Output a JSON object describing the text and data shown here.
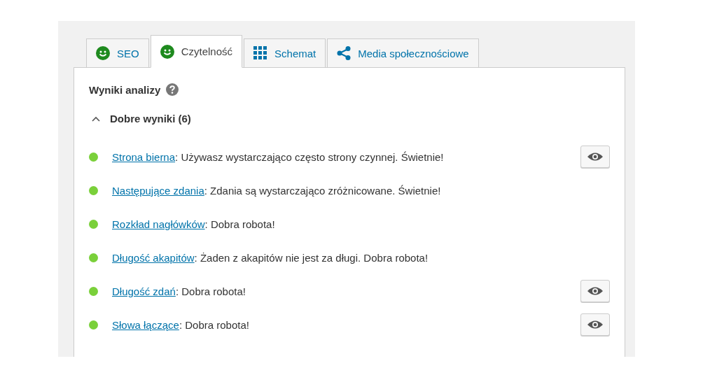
{
  "tabs": [
    {
      "label": "SEO",
      "kind": "smiley",
      "color": "#1e8a1e",
      "selected": false
    },
    {
      "label": "Czytelność",
      "kind": "smiley",
      "color": "#1e8a1e",
      "selected": true
    },
    {
      "label": "Schemat",
      "kind": "grid",
      "selected": false
    },
    {
      "label": "Media społecznościowe",
      "kind": "share",
      "selected": false
    }
  ],
  "analysis": {
    "title": "Wyniki analizy",
    "group": {
      "label": "Dobre wyniki (6)",
      "expanded": true,
      "results": [
        {
          "color": "#7ad03a",
          "link": "Strona bierna",
          "text": ": Używasz wystarczająco często strony czynnej. Świetnie!",
          "highlight_button": true
        },
        {
          "color": "#7ad03a",
          "link": "Następujące zdania",
          "text": ": Zdania są wystarczająco zróżnicowane. Świetnie!",
          "highlight_button": false
        },
        {
          "color": "#7ad03a",
          "link": "Rozkład nagłówków",
          "text": ": Dobra robota!",
          "highlight_button": false
        },
        {
          "color": "#7ad03a",
          "link": "Długość akapitów",
          "text": ": Żaden z akapitów nie jest za długi. Dobra robota!",
          "highlight_button": false
        },
        {
          "color": "#7ad03a",
          "link": "Długość zdań",
          "text": ": Dobra robota!",
          "highlight_button": true
        },
        {
          "color": "#7ad03a",
          "link": "Słowa łączące",
          "text": ": Dobra robota!",
          "highlight_button": true
        }
      ]
    }
  }
}
